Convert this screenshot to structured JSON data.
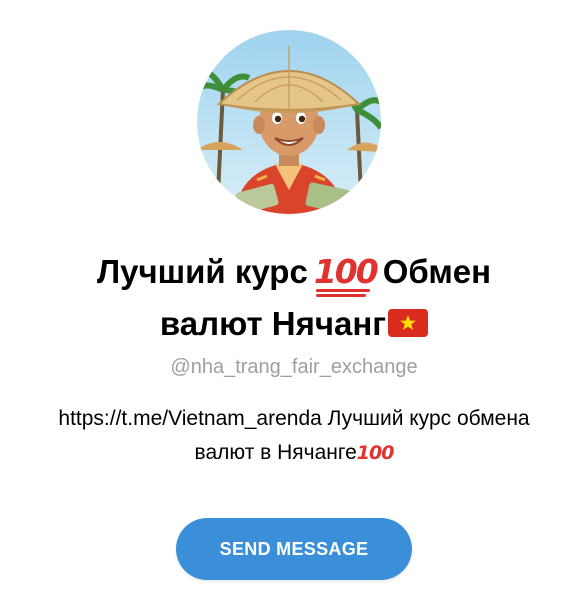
{
  "profile": {
    "name_line1": "Лучший курс",
    "name_line1_emoji": "100",
    "name_line1_after": "Обмен",
    "name_line2": "валют Нячанг",
    "name_flag": "vietnam-flag-icon",
    "username": "@nha_trang_fair_exchange",
    "description_line1": "https://t.me/Vietnam_arenda Лучший курс обмена",
    "description_line2": "валют в Нячанге",
    "description_emoji": "100"
  },
  "actions": {
    "send_label": "SEND MESSAGE"
  },
  "colors": {
    "button": "#3a8fd8",
    "username": "#9aa0a6",
    "emoji_red": "#e0322e",
    "flag_red": "#d92b1e",
    "flag_star": "#ffde00"
  }
}
